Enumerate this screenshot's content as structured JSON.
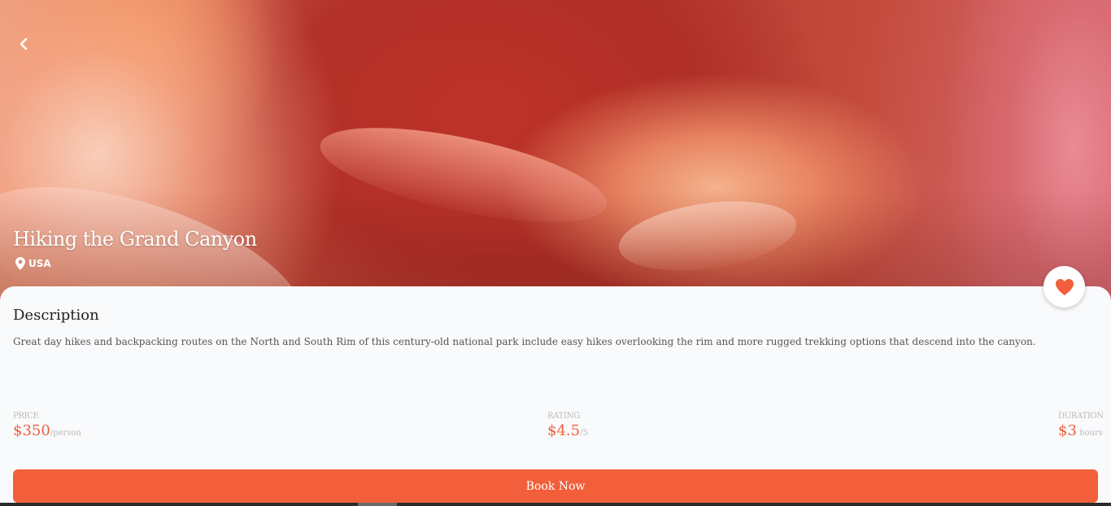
{
  "hero": {
    "title": "Hiking the Grand Canyon",
    "location": "USA",
    "back_icon": "chevron-left-icon",
    "location_icon": "map-pin-icon"
  },
  "favorite": {
    "icon": "heart-icon",
    "color": "#f25f3a"
  },
  "description": {
    "title": "Description",
    "text": "Great day hikes and backpacking routes on the North and South Rim of this century-old national park include easy hikes overlooking the rim and more rugged trekking options that descend into the canyon."
  },
  "stats": {
    "price": {
      "label": "PRICE",
      "value": "$350",
      "unit": "/person"
    },
    "rating": {
      "label": "RATING",
      "value": "$4.5",
      "unit": "/5"
    },
    "duration": {
      "label": "DURATION",
      "value": "$3",
      "unit": " hours"
    }
  },
  "actions": {
    "book_label": "Book Now"
  },
  "colors": {
    "accent": "#f25f3a",
    "value_text": "#ef5e3c",
    "muted": "#b9b9b9",
    "background": "#f9fafc"
  }
}
